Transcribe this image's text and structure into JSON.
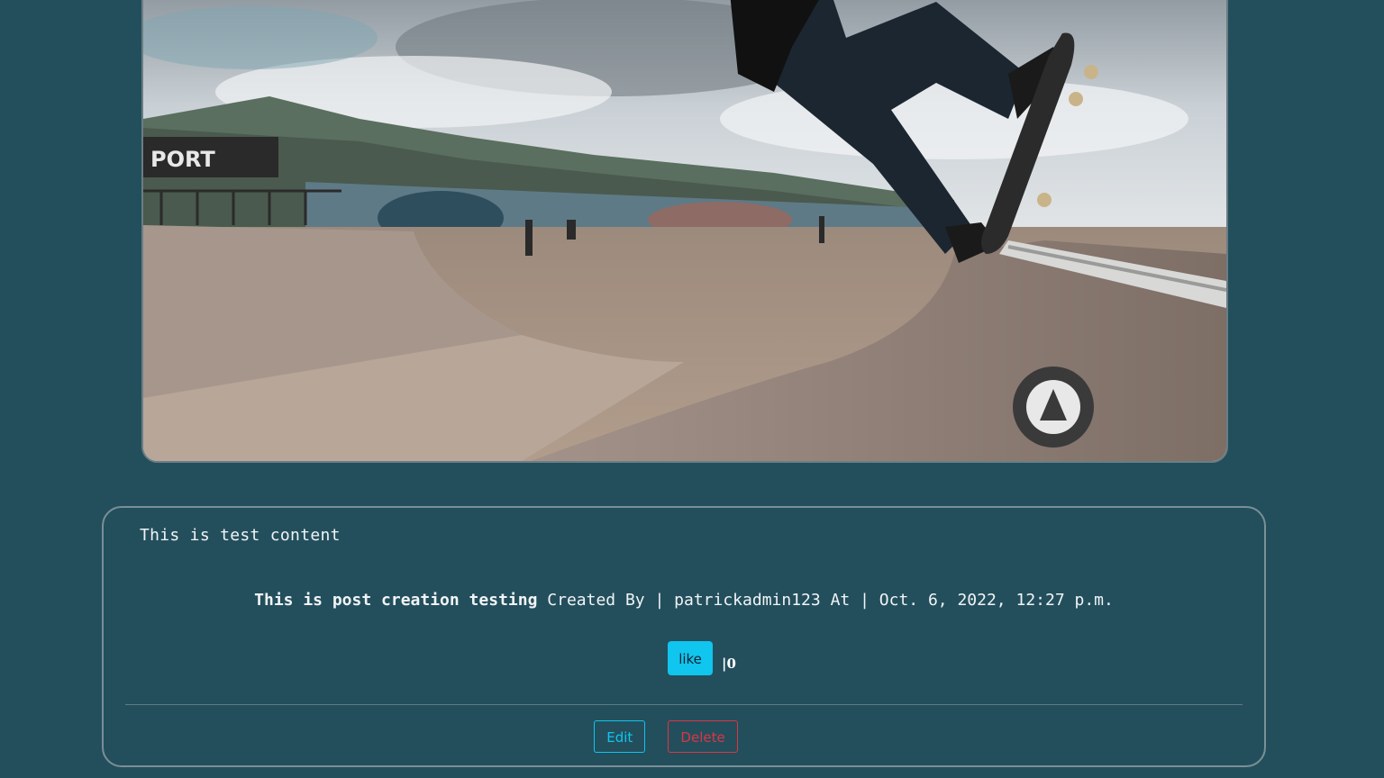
{
  "hero": {
    "image_alt": "skateboarder grinding on a skatepark ramp",
    "banner_text": "PORT"
  },
  "post": {
    "content": "This is test content",
    "title": "This is post creation testing",
    "created_by_label": "Created By |",
    "author": "patrickadmin123",
    "at_label": "At |",
    "date": "Oct. 6, 2022, 12:27 p.m.",
    "like_label": "like",
    "like_separator": "|",
    "like_count": "0",
    "edit_label": "Edit",
    "delete_label": "Delete"
  },
  "colors": {
    "background": "#234f5d",
    "like_button": "#10c5ee",
    "edit_accent": "#10c5ee",
    "delete_accent": "#dc3545"
  }
}
